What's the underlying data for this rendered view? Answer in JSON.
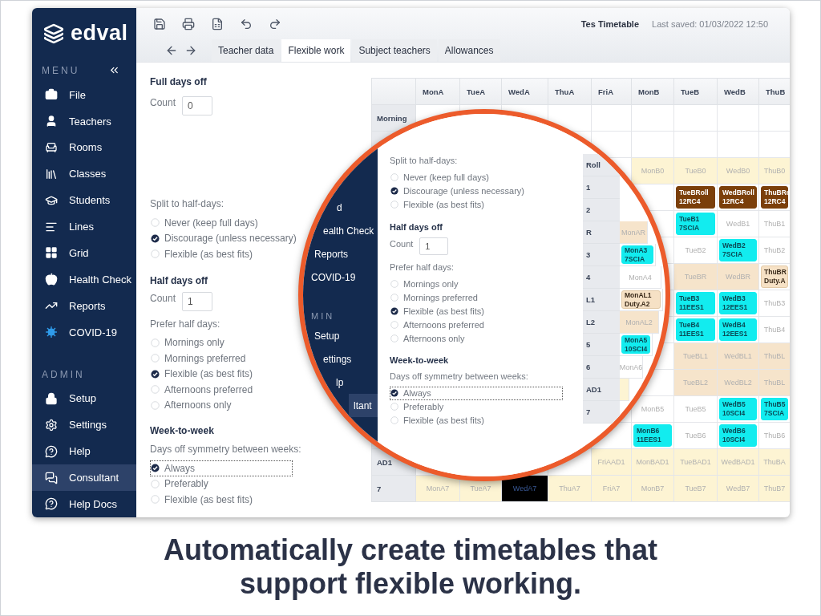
{
  "sidebar": {
    "logo": "edval",
    "menu_heading": "MENU",
    "menu_items": [
      {
        "label": "File",
        "selected": false
      },
      {
        "label": "Teachers",
        "selected": false
      },
      {
        "label": "Rooms",
        "selected": false
      },
      {
        "label": "Classes",
        "selected": false
      },
      {
        "label": "Students",
        "selected": false
      },
      {
        "label": "Lines",
        "selected": false
      },
      {
        "label": "Grid",
        "selected": false
      },
      {
        "label": "Health Check",
        "selected": false
      },
      {
        "label": "Reports",
        "selected": false
      },
      {
        "label": "COVID-19",
        "selected": false
      }
    ],
    "admin_heading": "ADMIN",
    "admin_items": [
      {
        "label": "Setup",
        "selected": false
      },
      {
        "label": "Settings",
        "selected": false
      },
      {
        "label": "Help",
        "selected": false
      },
      {
        "label": "Consultant",
        "selected": true
      },
      {
        "label": "Help Docs",
        "selected": false
      }
    ]
  },
  "toolbar": {
    "document": "Tes Timetable",
    "last_saved": "Last saved: 01/03/2022 12:50"
  },
  "tabs": [
    {
      "label": "Teacher data",
      "selected": false
    },
    {
      "label": "Flexible work",
      "selected": true
    },
    {
      "label": "Subject teachers",
      "selected": false
    },
    {
      "label": "Allowances",
      "selected": false
    }
  ],
  "form": {
    "full_days_off": {
      "title": "Full days off",
      "count_label": "Count",
      "count_value": "0"
    },
    "split": {
      "label": "Split to half-days:",
      "options": [
        {
          "label": "Never (keep full days)",
          "selected": false
        },
        {
          "label": "Discourage (unless necessary)",
          "selected": true
        },
        {
          "label": "Flexible (as best fits)",
          "selected": false
        }
      ]
    },
    "half_days_off": {
      "title": "Half days off",
      "count_label": "Count",
      "count_value": "1"
    },
    "prefer": {
      "label": "Prefer half days:",
      "options": [
        {
          "label": "Mornings only",
          "selected": false
        },
        {
          "label": "Mornings preferred",
          "selected": false
        },
        {
          "label": "Flexible (as best fits)",
          "selected": true
        },
        {
          "label": "Afternoons preferred",
          "selected": false
        },
        {
          "label": "Afternoons only",
          "selected": false
        }
      ]
    },
    "week": {
      "title": "Week-to-week",
      "label": "Days off symmetry between weeks:",
      "options": [
        {
          "label": "Always",
          "selected": true,
          "focused": true
        },
        {
          "label": "Preferably",
          "selected": false,
          "focused": false
        },
        {
          "label": "Flexible (as best fits)",
          "selected": false,
          "focused": false
        }
      ]
    }
  },
  "timetable": {
    "columns": [
      "MonA",
      "TueA",
      "WedA",
      "ThuA",
      "FriA",
      "MonB",
      "TueB",
      "WedB",
      "ThuB"
    ],
    "rows": [
      {
        "label": "Morning",
        "cells": [
          null,
          null,
          null,
          null,
          null,
          null,
          null,
          null,
          null
        ]
      },
      {
        "cells": [
          null,
          null,
          null,
          null,
          null,
          null,
          null,
          null,
          null
        ]
      },
      {
        "cells": [
          null,
          null,
          null,
          null,
          null,
          {
            "kind": "yellow",
            "text": "MonB0"
          },
          {
            "kind": "yellow",
            "text": "TueB0"
          },
          {
            "kind": "yellow",
            "text": "WedB0"
          },
          {
            "kind": "yellow",
            "text": "ThuB0"
          }
        ]
      },
      {
        "cells": [
          null,
          null,
          null,
          null,
          null,
          null,
          {
            "kind": "brown",
            "text": "TueBRoll\n12RC4"
          },
          {
            "kind": "brown",
            "text": "WedBRoll\n12RC4"
          },
          {
            "kind": "brown",
            "text": "ThuBRo\n12RC4"
          }
        ]
      },
      {
        "cells": [
          null,
          null,
          null,
          null,
          null,
          null,
          {
            "kind": "cyan",
            "text": "TueB1\n7SCIA"
          },
          {
            "kind": "white",
            "text": "WedB1"
          },
          {
            "kind": "white",
            "text": "ThuB1"
          }
        ]
      },
      {
        "cells": [
          null,
          null,
          null,
          null,
          null,
          null,
          {
            "kind": "white",
            "text": "TueB2"
          },
          {
            "kind": "cyan",
            "text": "WedB2\n7SCIA"
          },
          {
            "kind": "white",
            "text": "ThuB2"
          }
        ]
      },
      {
        "cells": [
          null,
          null,
          null,
          null,
          null,
          null,
          {
            "kind": "peach",
            "text": "TueBR"
          },
          {
            "kind": "peach",
            "text": "WedBR"
          },
          {
            "kind": "duty",
            "text": "ThuBR\nDuty.A"
          }
        ]
      },
      {
        "cells": [
          null,
          null,
          null,
          null,
          null,
          null,
          {
            "kind": "cyan",
            "text": "TueB3\n11EES1"
          },
          {
            "kind": "cyan",
            "text": "WedB3\n12EES1"
          },
          {
            "kind": "white",
            "text": "ThuB3"
          }
        ]
      },
      {
        "cells": [
          null,
          null,
          null,
          null,
          null,
          null,
          {
            "kind": "cyan",
            "text": "TueB4\n11EES1"
          },
          {
            "kind": "cyan",
            "text": "WedB4\n12EES1"
          },
          {
            "kind": "white",
            "text": "ThuB4"
          }
        ]
      },
      {
        "cells": [
          null,
          null,
          null,
          null,
          null,
          null,
          {
            "kind": "peach",
            "text": "TueBL1"
          },
          {
            "kind": "peach",
            "text": "WedBL1"
          },
          {
            "kind": "peach",
            "text": "ThuBL"
          }
        ]
      },
      {
        "cells": [
          null,
          null,
          null,
          null,
          null,
          null,
          {
            "kind": "peach",
            "text": "TueBL2"
          },
          {
            "kind": "peach",
            "text": "WedBL2"
          },
          {
            "kind": "peach",
            "text": "ThuBL"
          }
        ]
      },
      {
        "cells": [
          null,
          null,
          null,
          null,
          null,
          {
            "kind": "white",
            "text": "MonB5"
          },
          {
            "kind": "white",
            "text": "TueB5"
          },
          {
            "kind": "cyan",
            "text": "WedB5\n10SCI4"
          },
          {
            "kind": "cyan",
            "text": "ThuB5\n7SCIA"
          }
        ]
      },
      {
        "cells": [
          null,
          null,
          null,
          null,
          null,
          {
            "kind": "cyan",
            "text": "MonB6\n11EES1"
          },
          {
            "kind": "white",
            "text": "TueB6"
          },
          {
            "kind": "cyan",
            "text": "WedB6\n10SCI4"
          },
          {
            "kind": "white",
            "text": "ThuB6"
          }
        ]
      },
      {
        "label": "AD1",
        "cells": [
          null,
          null,
          null,
          null,
          {
            "kind": "yellow",
            "text": "FriAAD1"
          },
          {
            "kind": "yellow",
            "text": "MonBAD1"
          },
          {
            "kind": "yellow",
            "text": "TueBAD1"
          },
          {
            "kind": "yellow",
            "text": "WedBAD1"
          },
          {
            "kind": "yellow",
            "text": "ThuBA"
          }
        ]
      },
      {
        "label": "7",
        "cells": [
          {
            "kind": "yellow",
            "text": "MonA7"
          },
          {
            "kind": "yellow",
            "text": "TueA7"
          },
          {
            "kind": "black",
            "text": "WedA7"
          },
          {
            "kind": "yellow",
            "text": "ThuA7"
          },
          {
            "kind": "yellow",
            "text": "FriA7"
          },
          {
            "kind": "yellow",
            "text": "MonB7"
          },
          {
            "kind": "yellow",
            "text": "TueB7"
          },
          {
            "kind": "yellow",
            "text": "WedB7"
          },
          {
            "kind": "yellow",
            "text": "ThuB7"
          }
        ]
      }
    ]
  },
  "magnifier": {
    "sidebar": [
      {
        "kind": "item",
        "label": "d",
        "selected": false
      },
      {
        "kind": "item",
        "label": "ealth Check",
        "selected": false
      },
      {
        "kind": "item",
        "label": "Reports",
        "selected": false
      },
      {
        "kind": "item",
        "label": "COVID-19",
        "selected": false
      },
      {
        "kind": "heading",
        "label": "MIN"
      },
      {
        "kind": "item",
        "label": "Setup",
        "selected": false
      },
      {
        "kind": "item",
        "label": "ettings",
        "selected": false
      },
      {
        "kind": "item",
        "label": "lp",
        "selected": false
      },
      {
        "kind": "item",
        "label": "ltant",
        "selected": true
      }
    ],
    "form": {
      "split": {
        "label": "Split to half-days:",
        "options": [
          {
            "label": "Never (keep full days)",
            "selected": false
          },
          {
            "label": "Discourage (unless necessary)",
            "selected": true
          },
          {
            "label": "Flexible (as best fits)",
            "selected": false
          }
        ]
      },
      "half_days_off": {
        "title": "Half days off",
        "count_label": "Count",
        "count_value": "1"
      },
      "prefer": {
        "label": "Prefer half days:",
        "options": [
          {
            "label": "Mornings only",
            "selected": false
          },
          {
            "label": "Mornings preferred",
            "selected": false
          },
          {
            "label": "Flexible (as best fits)",
            "selected": true
          },
          {
            "label": "Afternoons preferred",
            "selected": false
          },
          {
            "label": "Afternoons only",
            "selected": false
          }
        ]
      },
      "week": {
        "title": "Week-to-week",
        "label": "Days off symmetry between weeks:",
        "options": [
          {
            "label": "Always",
            "selected": true,
            "focused": true
          },
          {
            "label": "Preferably",
            "selected": false,
            "focused": false
          },
          {
            "label": "Flexible (as best fits)",
            "selected": false,
            "focused": false
          }
        ]
      }
    },
    "timetable": [
      {
        "label": "Roll"
      },
      {
        "label": "1"
      },
      {
        "label": "2"
      },
      {
        "label": "R",
        "cell": {
          "kind": "peach",
          "text": "MonAR"
        }
      },
      {
        "label": "3",
        "cell": {
          "kind": "cyan",
          "text": "MonA3\n7SCIA"
        }
      },
      {
        "label": "4",
        "cell": {
          "kind": "white",
          "text": "MonA4"
        }
      },
      {
        "label": "L1",
        "cell": {
          "kind": "duty",
          "text": "MonAL1\nDuty.A2"
        }
      },
      {
        "label": "L2",
        "cell": {
          "kind": "peach",
          "text": "MonAL2"
        }
      },
      {
        "label": "5",
        "cell": {
          "kind": "cyan",
          "text": "MonA5\n10SCI4"
        }
      },
      {
        "label": "6",
        "cell": {
          "kind": "white",
          "text": "MonA6"
        }
      },
      {
        "label": "AD1",
        "cell": {
          "kind": "yellow"
        }
      },
      {
        "label": "7"
      }
    ]
  },
  "caption": "Automatically create timetables that support flexible working."
}
